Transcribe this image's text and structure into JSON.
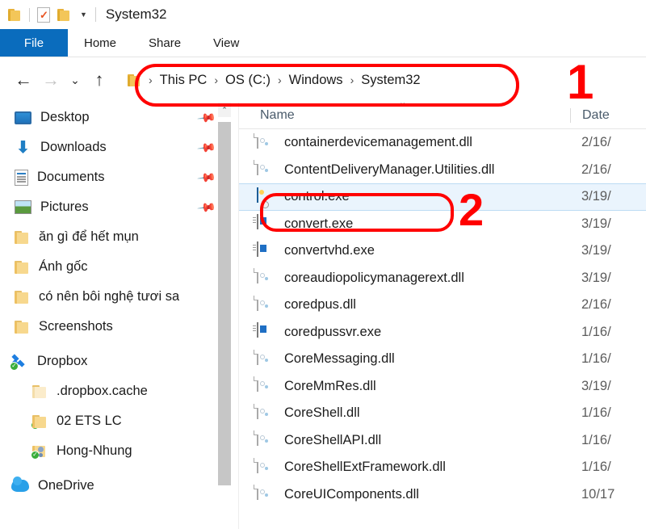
{
  "window": {
    "title": "System32",
    "quick_access": {
      "folder_icon": "folder-icon",
      "properties_icon": "properties-checkmark-icon",
      "new_folder_icon": "new-folder-icon",
      "customize_caret": "chevron-down-icon"
    }
  },
  "ribbon": {
    "tabs": [
      {
        "label": "File",
        "active": true
      },
      {
        "label": "Home",
        "active": false
      },
      {
        "label": "Share",
        "active": false
      },
      {
        "label": "View",
        "active": false
      }
    ]
  },
  "navbar": {
    "back_icon": "back-arrow-icon",
    "forward_icon": "forward-arrow-icon",
    "recent_icon": "recent-locations-chevron-icon",
    "up_icon": "up-arrow-icon",
    "breadcrumbs": [
      "This PC",
      "OS (C:)",
      "Windows",
      "System32"
    ],
    "separator": "›"
  },
  "sidebar": {
    "items": [
      {
        "label": "Desktop",
        "icon": "monitor-icon",
        "indent": 0,
        "pinned": true,
        "sync": false
      },
      {
        "label": "Downloads",
        "icon": "download-icon",
        "indent": 0,
        "pinned": true,
        "sync": false
      },
      {
        "label": "Documents",
        "icon": "document-icon",
        "indent": 0,
        "pinned": true,
        "sync": false
      },
      {
        "label": "Pictures",
        "icon": "pictures-icon",
        "indent": 0,
        "pinned": true,
        "sync": false
      },
      {
        "label": "ăn gì để hết mụn",
        "icon": "folder-icon",
        "indent": 0,
        "pinned": false,
        "sync": false
      },
      {
        "label": "Ảnh gốc",
        "icon": "folder-icon",
        "indent": 0,
        "pinned": false,
        "sync": false
      },
      {
        "label": "có nên bôi nghệ tươi sa",
        "icon": "folder-icon",
        "indent": 0,
        "pinned": false,
        "sync": false
      },
      {
        "label": "Screenshots",
        "icon": "folder-icon",
        "indent": 0,
        "pinned": false,
        "sync": false
      },
      {
        "label": "Dropbox",
        "icon": "dropbox-icon",
        "indent": -1,
        "pinned": false,
        "sync": true
      },
      {
        "label": ".dropbox.cache",
        "icon": "folder-pale-icon",
        "indent": 0,
        "pinned": false,
        "sync": false
      },
      {
        "label": "02 ETS LC",
        "icon": "folder-icon",
        "indent": 0,
        "pinned": false,
        "sync": true
      },
      {
        "label": "Hong-Nhung",
        "icon": "shared-folder-icon",
        "indent": 0,
        "pinned": false,
        "sync": true
      },
      {
        "label": "OneDrive",
        "icon": "onedrive-icon",
        "indent": -1,
        "pinned": false,
        "sync": false
      }
    ],
    "scrollbar": {
      "up_arrow_icon": "scroll-up-arrow-icon"
    }
  },
  "filelist": {
    "columns": [
      {
        "key": "name",
        "label": "Name",
        "sorted": "asc"
      },
      {
        "key": "date",
        "label": "Date"
      }
    ],
    "sort_caret_icon": "sort-ascending-caret-icon",
    "rows": [
      {
        "name": "containerdevicemanagement.dll",
        "date": "2/16/",
        "icon": "dll-icon",
        "selected": false
      },
      {
        "name": "ContentDeliveryManager.Utilities.dll",
        "date": "2/16/",
        "icon": "dll-icon",
        "selected": false
      },
      {
        "name": "control.exe",
        "date": "3/19/",
        "icon": "control-panel-icon",
        "selected": true
      },
      {
        "name": "convert.exe",
        "date": "3/19/",
        "icon": "exe-icon",
        "selected": false
      },
      {
        "name": "convertvhd.exe",
        "date": "3/19/",
        "icon": "exe-icon",
        "selected": false
      },
      {
        "name": "coreaudiopolicymanagerext.dll",
        "date": "3/19/",
        "icon": "dll-icon",
        "selected": false
      },
      {
        "name": "coredpus.dll",
        "date": "2/16/",
        "icon": "dll-icon",
        "selected": false
      },
      {
        "name": "coredpussvr.exe",
        "date": "1/16/",
        "icon": "exe-icon",
        "selected": false
      },
      {
        "name": "CoreMessaging.dll",
        "date": "1/16/",
        "icon": "dll-icon",
        "selected": false
      },
      {
        "name": "CoreMmRes.dll",
        "date": "3/19/",
        "icon": "dll-icon",
        "selected": false
      },
      {
        "name": "CoreShell.dll",
        "date": "1/16/",
        "icon": "dll-icon",
        "selected": false
      },
      {
        "name": "CoreShellAPI.dll",
        "date": "1/16/",
        "icon": "dll-icon",
        "selected": false
      },
      {
        "name": "CoreShellExtFramework.dll",
        "date": "1/16/",
        "icon": "dll-icon",
        "selected": false
      },
      {
        "name": "CoreUIComponents.dll",
        "date": "10/17",
        "icon": "dll-icon",
        "selected": false
      }
    ]
  },
  "annotations": {
    "color": "#ff0000",
    "markers": [
      {
        "id": "1",
        "label": "1",
        "target": "address-bar-breadcrumb"
      },
      {
        "id": "2",
        "label": "2",
        "target": "control-exe-row"
      }
    ]
  }
}
